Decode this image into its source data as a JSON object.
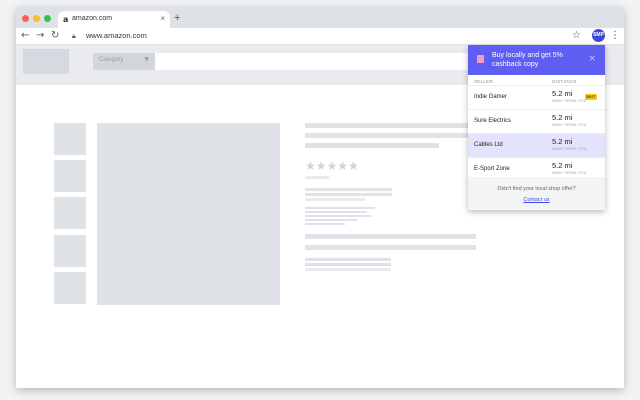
{
  "browser": {
    "tab_title": "amazon.com",
    "tab_favicon": "a",
    "url": "www.amazon.com",
    "profile_initials": "SMP",
    "icons": [
      "back-icon",
      "forward-icon",
      "reload-icon",
      "lock-icon",
      "star-icon",
      "kebab-menu-icon",
      "close-icon",
      "new-tab-icon"
    ]
  },
  "site": {
    "category_label": "Category",
    "rating_stars": "★★★★★"
  },
  "popup": {
    "title": "Buy locally and get 5% cashback copy",
    "col_seller": "SELLER",
    "col_distance": "DISTANCE",
    "rows": [
      {
        "seller": "Indie Gamer",
        "distance": "5.2 mi",
        "sub": "AWAY FROM YOU",
        "badge": "BEST"
      },
      {
        "seller": "Sure Electrics",
        "distance": "5.2 mi",
        "sub": "AWAY FROM YOU"
      },
      {
        "seller": "Cables Ltd",
        "distance": "5.2 mi",
        "sub": "AWAY FROM YOU"
      },
      {
        "seller": "E-Sport Zone",
        "distance": "5.2 mi",
        "sub": "AWAY FROM YOU"
      }
    ],
    "footer_question": "Didn't find your local shop offer?",
    "footer_link": "Contact us",
    "accent": "#5f5ef2",
    "selected_row_bg": "#e3e3fc"
  }
}
